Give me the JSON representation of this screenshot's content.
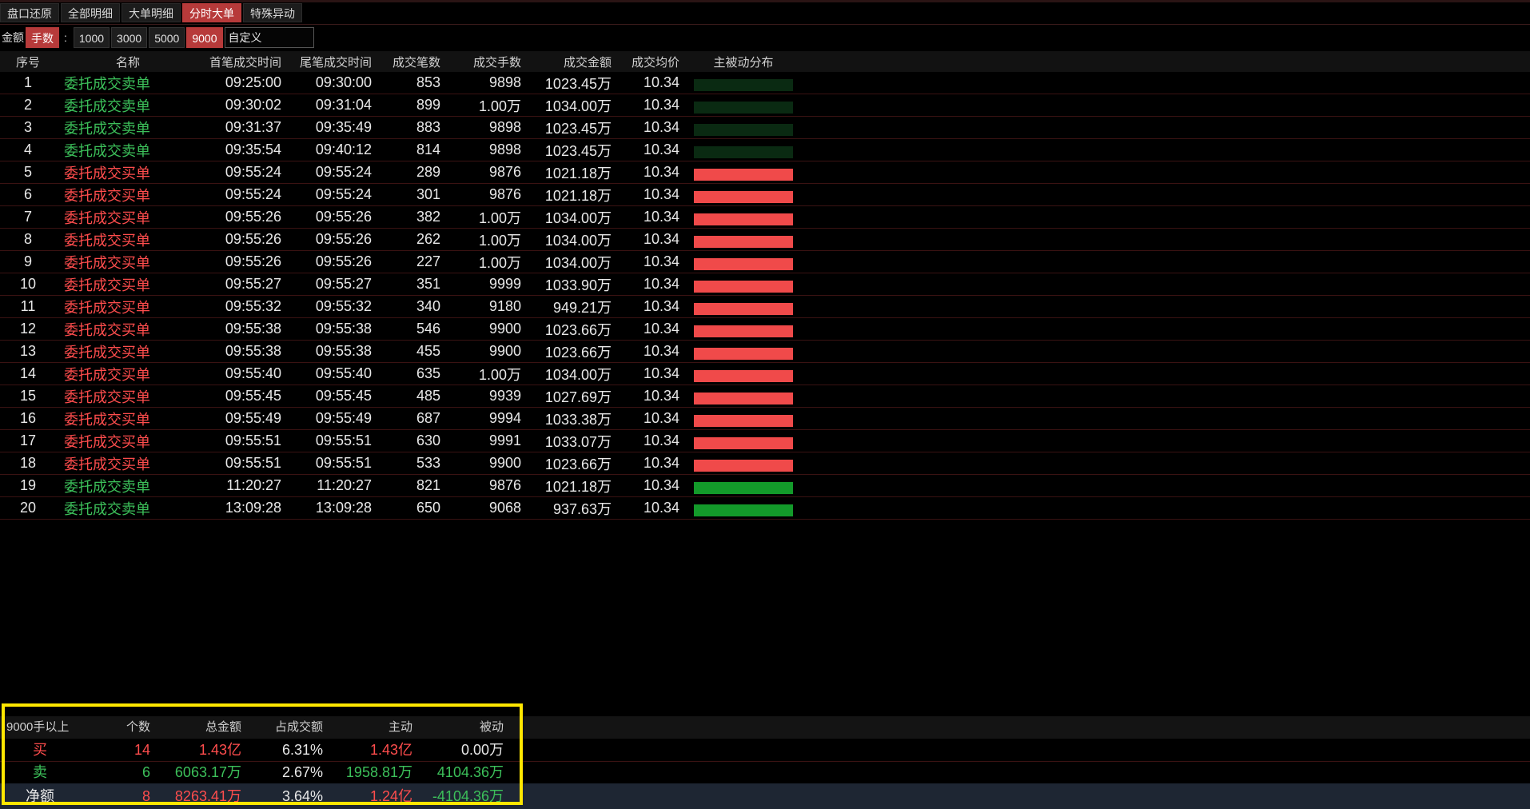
{
  "tabs": [
    {
      "label": "盘口还原",
      "active": false
    },
    {
      "label": "全部明细",
      "active": false
    },
    {
      "label": "大单明细",
      "active": false
    },
    {
      "label": "分时大单",
      "active": true
    },
    {
      "label": "特殊异动",
      "active": false
    }
  ],
  "filter": {
    "amount_label": "金额",
    "hands_label": "手数",
    "colon": ":",
    "options": [
      {
        "label": "1000",
        "active": false
      },
      {
        "label": "3000",
        "active": false
      },
      {
        "label": "5000",
        "active": false
      },
      {
        "label": "9000",
        "active": true
      }
    ],
    "custom_value": "自定义"
  },
  "table": {
    "headers": {
      "seq": "序号",
      "name": "名称",
      "first_time": "首笔成交时间",
      "last_time": "尾笔成交时间",
      "count": "成交笔数",
      "volume": "成交手数",
      "amount": "成交金额",
      "avg_price": "成交均价",
      "distribution": "主被动分布"
    },
    "rows": [
      {
        "seq": "1",
        "name": "委托成交卖单",
        "first": "09:25:00",
        "last": "09:30:00",
        "count": "853",
        "volume": "9898",
        "amount": "1023.45万",
        "avg": "10.34",
        "side": "sell",
        "bar": "#0a2a12"
      },
      {
        "seq": "2",
        "name": "委托成交卖单",
        "first": "09:30:02",
        "last": "09:31:04",
        "count": "899",
        "volume": "1.00万",
        "amount": "1034.00万",
        "avg": "10.34",
        "side": "sell",
        "bar": "#0a2a12"
      },
      {
        "seq": "3",
        "name": "委托成交卖单",
        "first": "09:31:37",
        "last": "09:35:49",
        "count": "883",
        "volume": "9898",
        "amount": "1023.45万",
        "avg": "10.34",
        "side": "sell",
        "bar": "#0a2a12"
      },
      {
        "seq": "4",
        "name": "委托成交卖单",
        "first": "09:35:54",
        "last": "09:40:12",
        "count": "814",
        "volume": "9898",
        "amount": "1023.45万",
        "avg": "10.34",
        "side": "sell",
        "bar": "#0a2a12"
      },
      {
        "seq": "5",
        "name": "委托成交买单",
        "first": "09:55:24",
        "last": "09:55:24",
        "count": "289",
        "volume": "9876",
        "amount": "1021.18万",
        "avg": "10.34",
        "side": "buy",
        "bar": "#f04a4a"
      },
      {
        "seq": "6",
        "name": "委托成交买单",
        "first": "09:55:24",
        "last": "09:55:24",
        "count": "301",
        "volume": "9876",
        "amount": "1021.18万",
        "avg": "10.34",
        "side": "buy",
        "bar": "#f04a4a"
      },
      {
        "seq": "7",
        "name": "委托成交买单",
        "first": "09:55:26",
        "last": "09:55:26",
        "count": "382",
        "volume": "1.00万",
        "amount": "1034.00万",
        "avg": "10.34",
        "side": "buy",
        "bar": "#f04a4a"
      },
      {
        "seq": "8",
        "name": "委托成交买单",
        "first": "09:55:26",
        "last": "09:55:26",
        "count": "262",
        "volume": "1.00万",
        "amount": "1034.00万",
        "avg": "10.34",
        "side": "buy",
        "bar": "#f04a4a"
      },
      {
        "seq": "9",
        "name": "委托成交买单",
        "first": "09:55:26",
        "last": "09:55:26",
        "count": "227",
        "volume": "1.00万",
        "amount": "1034.00万",
        "avg": "10.34",
        "side": "buy",
        "bar": "#f04a4a"
      },
      {
        "seq": "10",
        "name": "委托成交买单",
        "first": "09:55:27",
        "last": "09:55:27",
        "count": "351",
        "volume": "9999",
        "amount": "1033.90万",
        "avg": "10.34",
        "side": "buy",
        "bar": "#f04a4a"
      },
      {
        "seq": "11",
        "name": "委托成交买单",
        "first": "09:55:32",
        "last": "09:55:32",
        "count": "340",
        "volume": "9180",
        "amount": "949.21万",
        "avg": "10.34",
        "side": "buy",
        "bar": "#f04a4a"
      },
      {
        "seq": "12",
        "name": "委托成交买单",
        "first": "09:55:38",
        "last": "09:55:38",
        "count": "546",
        "volume": "9900",
        "amount": "1023.66万",
        "avg": "10.34",
        "side": "buy",
        "bar": "#f04a4a"
      },
      {
        "seq": "13",
        "name": "委托成交买单",
        "first": "09:55:38",
        "last": "09:55:38",
        "count": "455",
        "volume": "9900",
        "amount": "1023.66万",
        "avg": "10.34",
        "side": "buy",
        "bar": "#f04a4a"
      },
      {
        "seq": "14",
        "name": "委托成交买单",
        "first": "09:55:40",
        "last": "09:55:40",
        "count": "635",
        "volume": "1.00万",
        "amount": "1034.00万",
        "avg": "10.34",
        "side": "buy",
        "bar": "#f04a4a"
      },
      {
        "seq": "15",
        "name": "委托成交买单",
        "first": "09:55:45",
        "last": "09:55:45",
        "count": "485",
        "volume": "9939",
        "amount": "1027.69万",
        "avg": "10.34",
        "side": "buy",
        "bar": "#f04a4a"
      },
      {
        "seq": "16",
        "name": "委托成交买单",
        "first": "09:55:49",
        "last": "09:55:49",
        "count": "687",
        "volume": "9994",
        "amount": "1033.38万",
        "avg": "10.34",
        "side": "buy",
        "bar": "#f04a4a"
      },
      {
        "seq": "17",
        "name": "委托成交买单",
        "first": "09:55:51",
        "last": "09:55:51",
        "count": "630",
        "volume": "9991",
        "amount": "1033.07万",
        "avg": "10.34",
        "side": "buy",
        "bar": "#f04a4a"
      },
      {
        "seq": "18",
        "name": "委托成交买单",
        "first": "09:55:51",
        "last": "09:55:51",
        "count": "533",
        "volume": "9900",
        "amount": "1023.66万",
        "avg": "10.34",
        "side": "buy",
        "bar": "#f04a4a"
      },
      {
        "seq": "19",
        "name": "委托成交卖单",
        "first": "11:20:27",
        "last": "11:20:27",
        "count": "821",
        "volume": "9876",
        "amount": "1021.18万",
        "avg": "10.34",
        "side": "sell",
        "bar": "#139a2a"
      },
      {
        "seq": "20",
        "name": "委托成交卖单",
        "first": "13:09:28",
        "last": "13:09:28",
        "count": "650",
        "volume": "9068",
        "amount": "937.63万",
        "avg": "10.34",
        "side": "sell",
        "bar": "#139a2a"
      }
    ]
  },
  "summary": {
    "headers": {
      "label": "9000手以上",
      "count": "个数",
      "total": "总金额",
      "pct": "占成交额",
      "active": "主动",
      "passive": "被动"
    },
    "buy": {
      "label": "买",
      "count": "14",
      "total": "1.43亿",
      "pct": "6.31%",
      "active": "1.43亿",
      "passive": "0.00万"
    },
    "sell": {
      "label": "卖",
      "count": "6",
      "total": "6063.17万",
      "pct": "2.67%",
      "active": "1958.81万",
      "passive": "4104.36万"
    },
    "net": {
      "label": "净额",
      "count": "8",
      "total": "8263.41万",
      "pct": "3.64%",
      "active": "1.24亿",
      "passive": "-4104.36万"
    }
  },
  "colors": {
    "buy_text": "#ff4d4d",
    "sell_text": "#3cc05a",
    "active_tab": "#b73a3a",
    "highlight_border": "#ffe600"
  }
}
